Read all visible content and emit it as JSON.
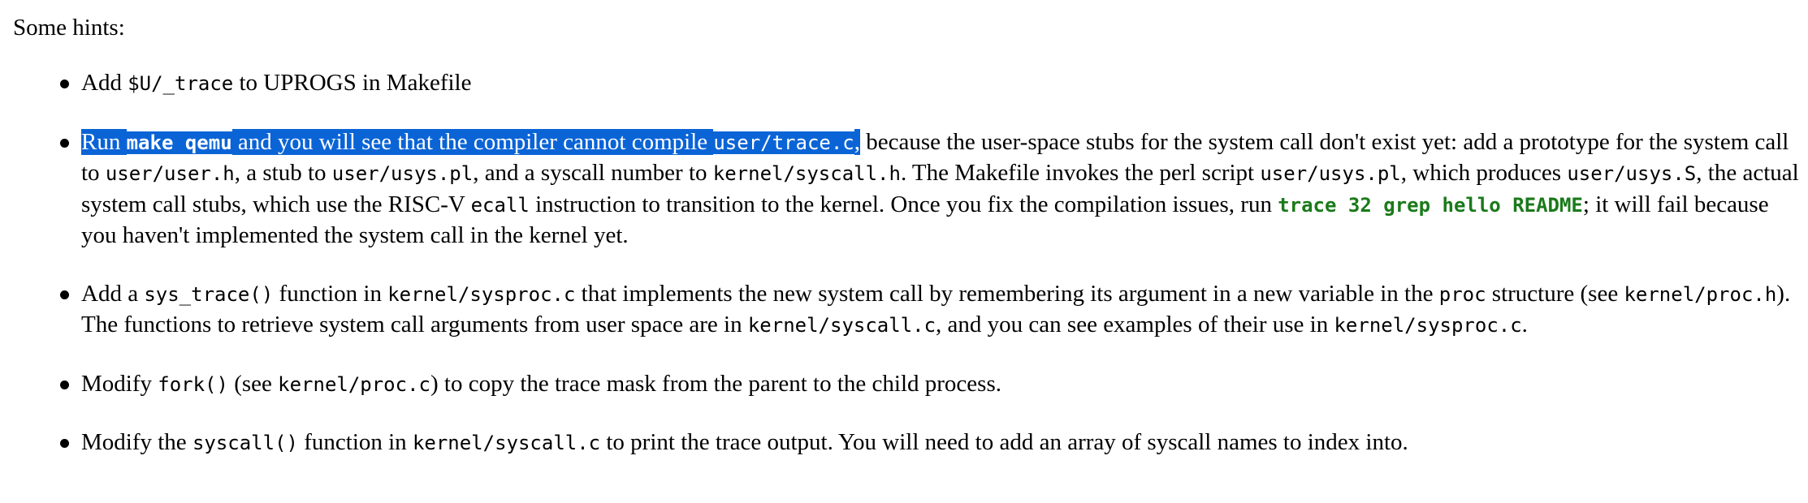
{
  "intro": "Some hints:",
  "colors": {
    "selection_bg": "#0a64d6",
    "selection_text": "#ffffff",
    "command_green": "#1a7a1a"
  },
  "hints": [
    {
      "parts": [
        {
          "t": "Add "
        },
        {
          "c": "$U/_trace"
        },
        {
          "t": " to UPROGS in Makefile"
        }
      ]
    },
    {
      "parts": [
        {
          "t": "Run ",
          "sel": true
        },
        {
          "k": "make qemu",
          "sel": true
        },
        {
          "t": " and you will see that the compiler cannot compile ",
          "sel": true
        },
        {
          "c": "user/trace.c",
          "sel": true
        },
        {
          "t": ",",
          "sel": true
        },
        {
          "t": " because the user-space stubs for the system call don't exist yet: add a prototype for the system call to "
        },
        {
          "c": "user/user.h"
        },
        {
          "t": ", a stub to "
        },
        {
          "c": "user/usys.pl"
        },
        {
          "t": ", and a syscall number to "
        },
        {
          "c": "kernel/syscall.h"
        },
        {
          "t": ". The Makefile invokes the perl script "
        },
        {
          "c": "user/usys.pl"
        },
        {
          "t": ", which produces "
        },
        {
          "c": "user/usys.S"
        },
        {
          "t": ", the actual system call stubs, which use the RISC-V "
        },
        {
          "c": "ecall"
        },
        {
          "t": " instruction to transition to the kernel. Once you fix the compilation issues, run "
        },
        {
          "g": "trace 32 grep hello README"
        },
        {
          "t": "; it will fail because you haven't implemented the system call in the kernel yet."
        }
      ]
    },
    {
      "parts": [
        {
          "t": "Add a "
        },
        {
          "c": "sys_trace()"
        },
        {
          "t": " function in "
        },
        {
          "c": "kernel/sysproc.c"
        },
        {
          "t": " that implements the new system call by remembering its argument in a new variable in the "
        },
        {
          "c": "proc"
        },
        {
          "t": " structure (see "
        },
        {
          "c": "kernel/proc.h"
        },
        {
          "t": "). The functions to retrieve system call arguments from user space are in "
        },
        {
          "c": "kernel/syscall.c"
        },
        {
          "t": ", and you can see examples of their use in "
        },
        {
          "c": "kernel/sysproc.c"
        },
        {
          "t": "."
        }
      ]
    },
    {
      "parts": [
        {
          "t": "Modify "
        },
        {
          "c": "fork()"
        },
        {
          "t": " (see "
        },
        {
          "c": "kernel/proc.c"
        },
        {
          "t": ") to copy the trace mask from the parent to the child process."
        }
      ]
    },
    {
      "parts": [
        {
          "t": "Modify the "
        },
        {
          "c": "syscall()"
        },
        {
          "t": " function in "
        },
        {
          "c": "kernel/syscall.c"
        },
        {
          "t": " to print the trace output. You will need to add an array of syscall names to index into."
        }
      ]
    }
  ]
}
